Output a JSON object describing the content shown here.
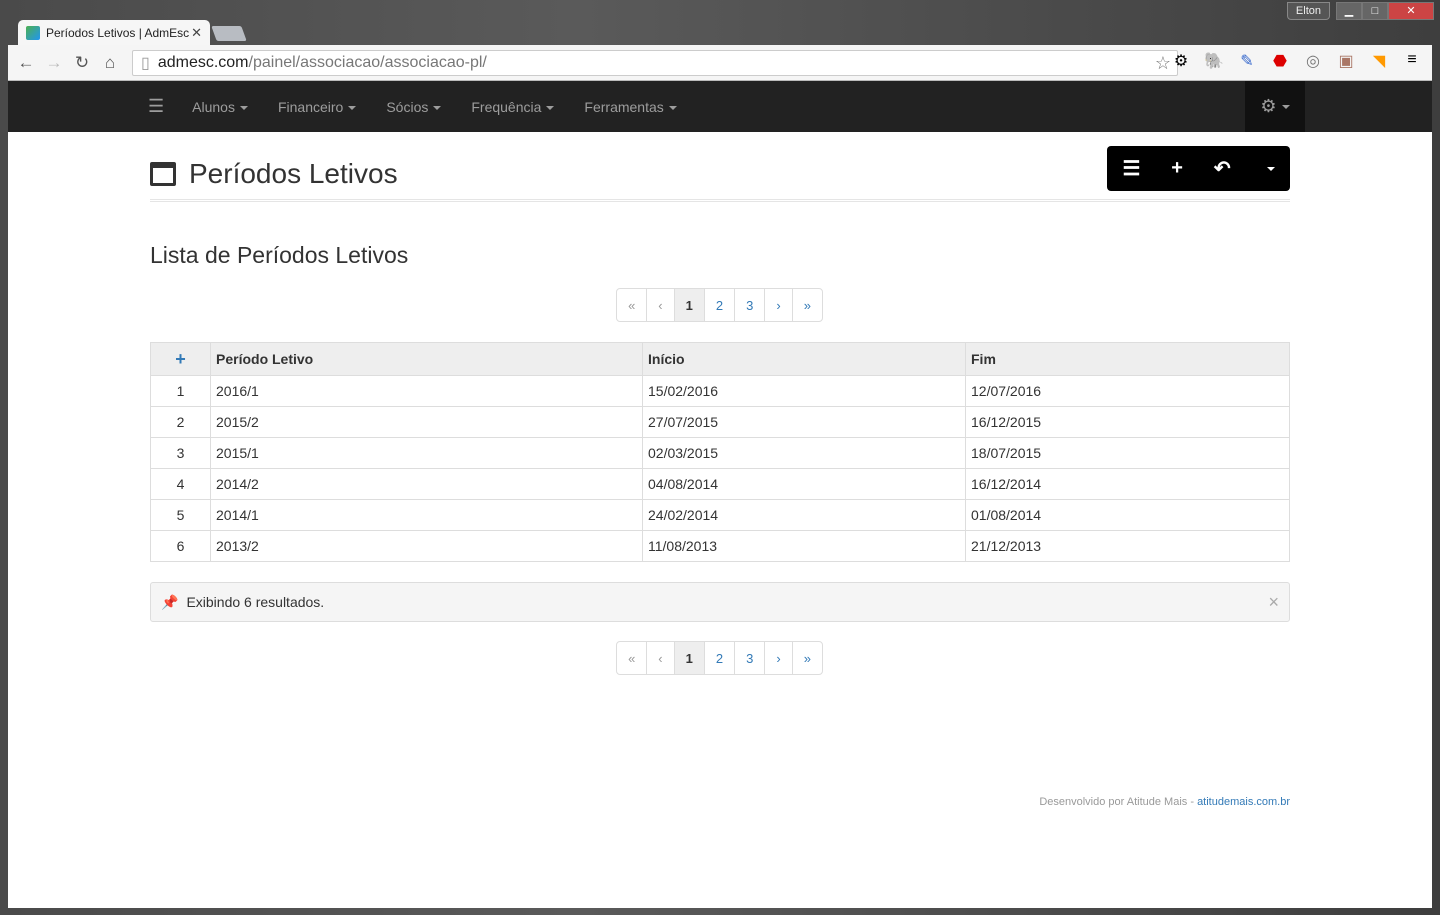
{
  "browser": {
    "tab_title": "Períodos Letivos | AdmEsc",
    "url_host": "admesc.com",
    "url_path": "/painel/associacao/associacao-pl/",
    "user": "Elton"
  },
  "navbar": {
    "items": [
      "Alunos",
      "Financeiro",
      "Sócios",
      "Frequência",
      "Ferramentas"
    ]
  },
  "page": {
    "title": "Períodos Letivos",
    "subtitle": "Lista de Períodos Letivos"
  },
  "pagination": {
    "first": "«",
    "prev": "‹",
    "pages": [
      "1",
      "2",
      "3"
    ],
    "current": "1",
    "next": "›",
    "last": "»"
  },
  "table": {
    "add": "+",
    "headers": [
      "Período Letivo",
      "Início",
      "Fim"
    ],
    "rows": [
      [
        "1",
        "2016/1",
        "15/02/2016",
        "12/07/2016"
      ],
      [
        "2",
        "2015/2",
        "27/07/2015",
        "16/12/2015"
      ],
      [
        "3",
        "2015/1",
        "02/03/2015",
        "18/07/2015"
      ],
      [
        "4",
        "2014/2",
        "04/08/2014",
        "16/12/2014"
      ],
      [
        "5",
        "2014/1",
        "24/02/2014",
        "01/08/2014"
      ],
      [
        "6",
        "2013/2",
        "11/08/2013",
        "21/12/2013"
      ]
    ]
  },
  "alert": {
    "text": "Exibindo 6 resultados."
  },
  "footer": {
    "text": "Desenvolvido por Atitude Mais - ",
    "link": "atitudemais.com.br"
  }
}
